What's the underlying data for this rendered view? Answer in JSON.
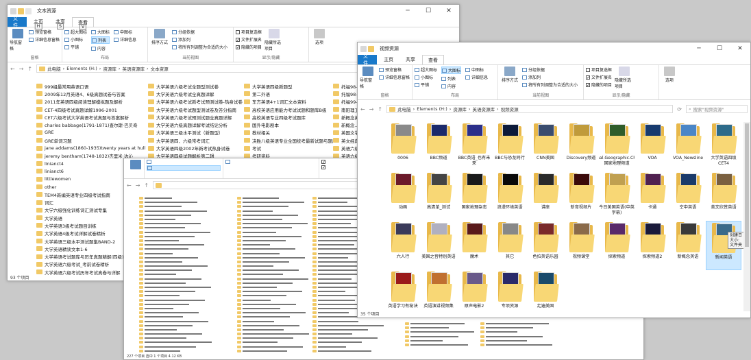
{
  "win1": {
    "title": "文本资源",
    "tabs": [
      "文件",
      "主页",
      "共享",
      "查看"
    ],
    "tab_keys": [
      "F",
      "H",
      "S",
      "V"
    ],
    "ribbon": {
      "nav_pane": "导航窗格",
      "preview_pane": "预览窗格",
      "details_pane": "详细信息窗格",
      "layout_items": [
        "超大图标",
        "大图标",
        "中图标",
        "小图标",
        "列表",
        "详细信息",
        "平铺",
        "内容"
      ],
      "sort": "排序方式",
      "group": "分组依据",
      "add_col": "添加列",
      "fit_cols": "将所有列调整为合适的大小",
      "chk_items": [
        "项目复选框",
        "文件扩展名",
        "隐藏的项目"
      ],
      "hide": "隐藏所选项目",
      "options": "选项",
      "group_labels": [
        "窗格",
        "布局",
        "当前视图",
        "显示/隐藏"
      ]
    },
    "path": [
      "此电脑",
      "Elements (H:)",
      "资源库",
      "英语资源库",
      "文本资源"
    ],
    "col1": [
      "999组最常用英语口语",
      "2009年12月英语4、6级真题试卷与答案",
      "2011年英语四级阅读理解模拟题及解析",
      "CET-4四级考试真题详解1996-2001",
      "CET六级考试大学英语考试真题与答案解析",
      "charles babbage(1791-1871)查尔斯·巴贝奇",
      "GRE",
      "GRE单词习题",
      "jane addams(1860-1935)twenty years at hull house",
      "jeremy bentham(1748-1832)杰里米·边沁",
      "linianct4",
      "linianct6",
      "littlewomen",
      "other",
      "TEM4新编英语专业四级考试指南",
      "词汇",
      "大学六级强化训练词汇测试专集",
      "大学英语",
      "大学英语3级考试题目训练",
      "大学英语4级考试详解试卷精析",
      "大学英语三级水平测试题集BAND-2",
      "大学英语精读文本1-6",
      "大学英语考试题库与历年真题精解(四级)",
      "大学英语六级考试_考前试卷精析",
      "大学英语六级考试历年考试真卷与详解"
    ],
    "col2": [
      "大学英语六级考试全题型测试卷",
      "大学英语六级考试全真题详解",
      "大学英语六级考试新考试预测试卷-热身试卷",
      "大学英语六级考试题型测试卷及答分指南",
      "大学英语六级考试预测试题全真题详解",
      "大学英语六级真题详解考试结论分析",
      "大学英语三级水平测试（新题型）",
      "大学英语四、六级常考词汇",
      "大学英语四级2002年新考试热身试卷",
      "大学英语四级试题解析第二辑",
      "大学英语四级考试专项训练"
    ],
    "col3": [
      "大学英语四级新题型",
      "第二外语",
      "东方英语4+1词汇文本资料",
      "高校英语应用能力考试试题和题库B级",
      "高校英语专业四级考试题库",
      "国外电影剧本",
      "教材相关",
      "决胜八级英语专业全国统考最新试题与题库",
      "考试",
      "考研资料"
    ],
    "col4": [
      "托福98-5",
      "托福98-8",
      "托福99-1",
      "南阳理工大学...",
      "新概念英语...",
      "新概念...",
      "英国文学...",
      "英文经典...",
      "英语六级...",
      "英语六级考试..."
    ],
    "status": "93 个项目"
  },
  "win2": {
    "title": "视频资源",
    "path": [
      "此电脑",
      "Elements (H:)",
      "资源库",
      "英语资源库",
      "视频资源"
    ],
    "search_placeholder": "搜索\"视频资源\"",
    "tiles": [
      "0006",
      "BBC频道",
      "BBC英语_也有未来",
      "BBC与恐龙同行",
      "CNN美国",
      "Discovery频道",
      "National.Geographic.Channel国家地理频道",
      "VOA",
      "VOA_Newsline",
      "大学英语四级CET4",
      "动画",
      "高清单_测试",
      "国家地理杂志",
      "浪漫环境英语",
      "讲座",
      "新育视频片",
      "今日美国英语(中英字幕)",
      "卡通",
      "空中英语",
      "美文欣赏英语",
      "六人行",
      "美国之音特别英语",
      "魔术",
      "其它",
      "色拉英语乐园",
      "视频课堂",
      "探索频道",
      "探索频道2",
      "新概念英语",
      "新闻英语",
      "英语学习有秘诀",
      "英语演讲视频集",
      "原声电影2",
      "专项资源",
      "走遍美国"
    ],
    "cover_colors": [
      "#8a8a8a",
      "#1b2a6b",
      "#2b2f8a",
      "#0c1a3a",
      "#3a4c6e",
      "#c09b3b",
      "#2f5d2a",
      "#173a6e",
      "#4a86c7",
      "#2d6b8a",
      "#6b1a2a",
      "#444",
      "#1a1a1a",
      "#0a0a0a",
      "#2a2a2a",
      "#3b0a0a",
      "#c0a050",
      "#4f2050",
      "#1a3a6a",
      "#7a6040",
      "#3a3a5a",
      "#b0b0c0",
      "#5a1a1a",
      "#888",
      "#7a2a2a",
      "#8a6a4a",
      "#5a2a6a",
      "#1a1a3a",
      "#3a3a3a",
      "#3a6a8a",
      "#9a1a1a",
      "#c07030",
      "#6a5a8a",
      "#2a2a6a",
      "#1a4a6a"
    ],
    "selected_index": 29,
    "tooltip": [
      "创建日",
      "大小:",
      "文件夹"
    ],
    "status": "35 个项目"
  },
  "win3": {
    "status": "227 个项目  选中 1 个项目  4.12 KB"
  }
}
